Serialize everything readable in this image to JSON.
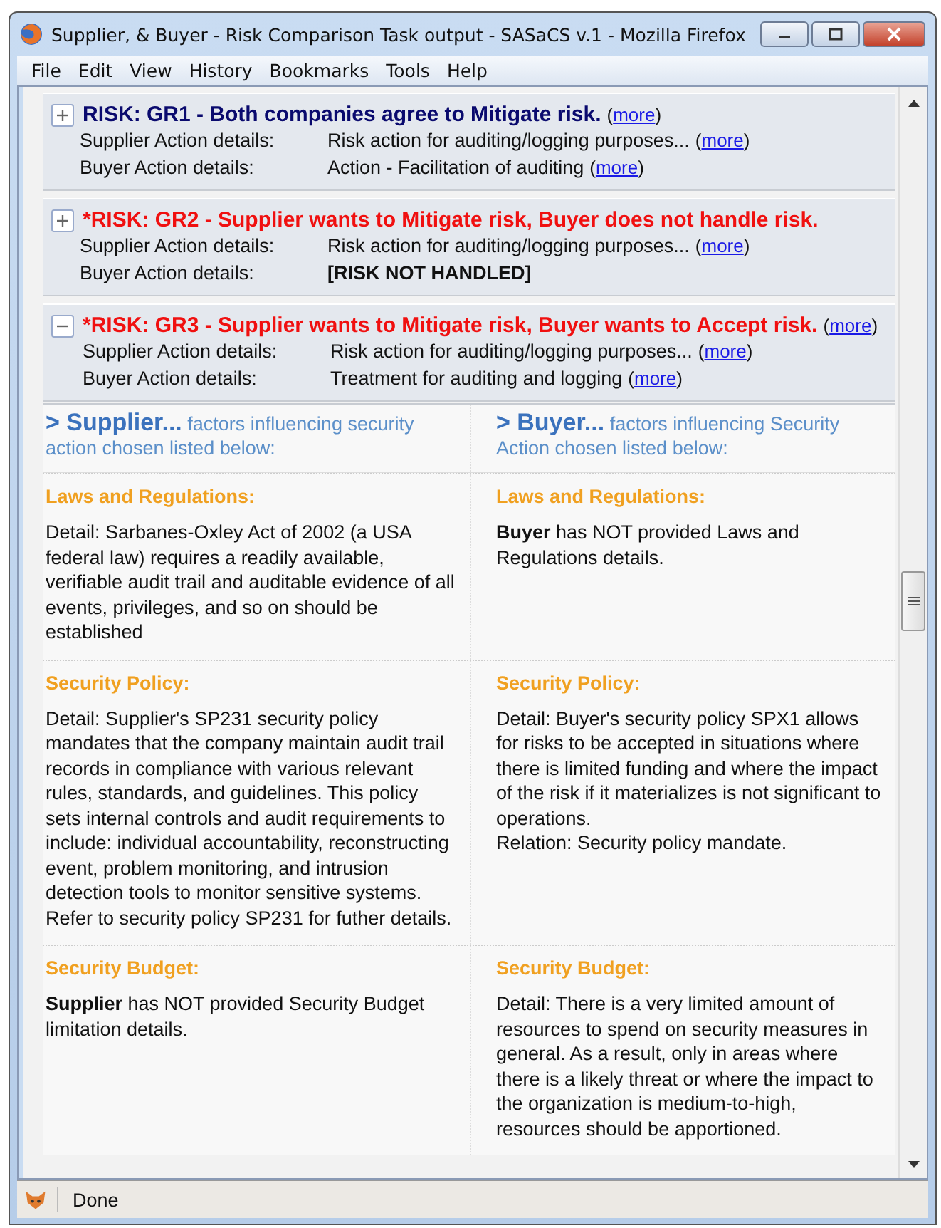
{
  "window": {
    "title": "Supplier, & Buyer - Risk Comparison Task output - SASaCS v.1 - Mozilla Firefox"
  },
  "menu": [
    "File",
    "Edit",
    "View",
    "History",
    "Bookmarks",
    "Tools",
    "Help"
  ],
  "risks": [
    {
      "expanded": false,
      "flagged": false,
      "title": "RISK: GR1 - Both companies agree to Mitigate risk.",
      "more": "(more)",
      "details": [
        {
          "label": "Supplier Action details:",
          "value": "Risk action for auditing/logging purposes...",
          "bold": false,
          "more": "(more)"
        },
        {
          "label": "Buyer Action details:",
          "value": "Action - Facilitation of auditing",
          "bold": false,
          "more": "(more)"
        }
      ]
    },
    {
      "expanded": false,
      "flagged": true,
      "title": "*RISK: GR2 - Supplier wants to Mitigate risk, Buyer does not handle risk.",
      "details": [
        {
          "label": "Supplier Action details:",
          "value": "Risk action for auditing/logging purposes...",
          "bold": false,
          "more": "(more)"
        },
        {
          "label": "Buyer Action details:",
          "value": "[RISK NOT HANDLED]",
          "bold": true
        }
      ]
    },
    {
      "expanded": true,
      "flagged": true,
      "title": "*RISK: GR3 - Supplier wants to Mitigate risk, Buyer wants to Accept risk.",
      "more": "(more)",
      "details": [
        {
          "label": "Supplier Action details:",
          "value": "Risk action for auditing/logging purposes...",
          "bold": false,
          "more": "(more)"
        },
        {
          "label": "Buyer Action details:",
          "value": "Treatment for auditing and logging",
          "bold": false,
          "more": "(more)"
        }
      ]
    }
  ],
  "comparison": {
    "columns": [
      {
        "name": "> Supplier...",
        "subtitle": "factors influencing security action chosen listed below:"
      },
      {
        "name": "> Buyer...",
        "subtitle": "factors influencing Security Action chosen listed below:"
      }
    ],
    "sections": [
      {
        "supplier_heading": "Laws and Regulations:",
        "buyer_heading": "Laws and Regulations:",
        "supplier_text": "Detail: Sarbanes-Oxley Act of 2002 (a USA federal law) requires a readily available, verifiable audit trail and auditable evidence of all events, privileges, and so on should be established",
        "buyer_text": "**Buyer** has NOT provided Laws and Regulations details."
      },
      {
        "supplier_heading": "Security Policy:",
        "buyer_heading": "Security Policy:",
        "supplier_text": "Detail:  Supplier's SP231 security policy mandates that the company maintain audit trail records in compliance with various relevant rules, standards, and guidelines. This policy sets internal controls and audit requirements to include: individual accountability, reconstructing event, problem monitoring, and intrusion detection tools to monitor sensitive systems. Refer to security policy SP231 for futher details.",
        "buyer_text": "Detail: Buyer's security policy SPX1 allows for risks to be accepted in situations where there is limited funding and where the impact of the risk if it materializes is not significant to operations.\nRelation: Security policy mandate."
      },
      {
        "supplier_heading": "Security Budget:",
        "buyer_heading": "Security Budget:",
        "supplier_text": "**Supplier** has NOT provided Security Budget limitation details.",
        "buyer_text": "Detail: There is a very limited amount of resources to spend on security measures in general. As a result, only in areas where there is a likely threat or where the impact to the organization is medium-to-high, resources should be apportioned."
      }
    ]
  },
  "status_bar": {
    "text": "Done"
  }
}
